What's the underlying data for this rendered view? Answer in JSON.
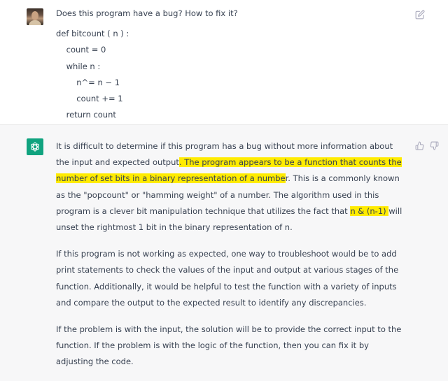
{
  "conversation": {
    "user_message": {
      "avatar": "user-photo-avatar",
      "question": "Does this program have a bug? How to fix it?",
      "code_lines": [
        "def bitcount ( n ) :",
        "    count = 0",
        "    while n :",
        "        n^= n − 1",
        "        count += 1",
        "    return count"
      ],
      "edit_icon": "edit-icon"
    },
    "assistant_message": {
      "avatar": "openai-logo-icon",
      "highlight_color": "#ffeb00",
      "paragraph_1": {
        "text_a": "It is difficult to determine if this program has a bug without more information about the input and expected output",
        "highlight_a": ". The program appears to be a function that counts the number of set bits in a binary representation of a numbe",
        "text_b": "r. This is a commonly known as the \"popcount\" or \"hamming weight\" of a number. The algorithm used in this program is a clever bit manipulation technique that utilizes the fact that ",
        "highlight_b": "n & (n-1) ",
        "text_c": "will unset the rightmost 1 bit in the binary representation of n."
      },
      "paragraph_2": "If this program is not working as expected, one way to troubleshoot would be to add print statements to check the values of the input and output at various stages of the function. Additionally, it would be helpful to test the function with a variety of inputs and compare the output to the expected result to identify any discrepancies.",
      "paragraph_3": "If the problem is with the input, the solution will be to provide the correct input to the function. If the problem is with the logic of the function, then you can fix it by adjusting the code.",
      "feedback_icons": [
        "thumbs-up-icon",
        "thumbs-down-icon"
      ]
    }
  },
  "colors": {
    "user_bg": "#ffffff",
    "assistant_bg": "#f7f7f8",
    "assistant_avatar_bg": "#10a37f",
    "text": "#374151",
    "icon": "#acacbe"
  }
}
